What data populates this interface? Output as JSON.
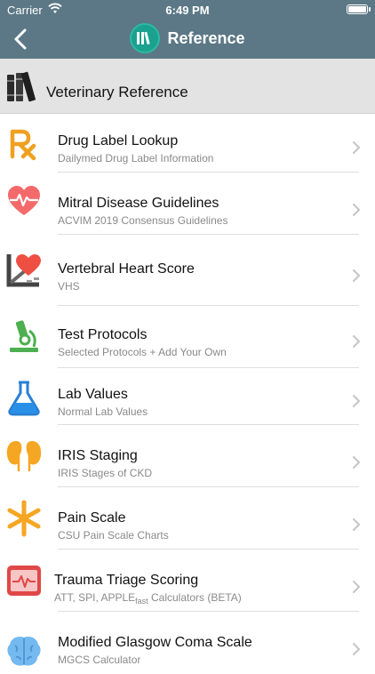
{
  "status": {
    "carrier": "Carrier",
    "time": "6:49 PM"
  },
  "nav": {
    "title": "Reference"
  },
  "section": {
    "label": "Veterinary Reference"
  },
  "items": [
    {
      "title": "Drug Label Lookup",
      "subtitle": "Dailymed Drug Label Information",
      "icon": "rx-icon"
    },
    {
      "title": "Mitral Disease Guidelines",
      "subtitle": "ACVIM 2019 Consensus Guidelines",
      "icon": "heart-pulse-icon"
    },
    {
      "title": "Vertebral Heart Score",
      "subtitle": "VHS",
      "icon": "xray-heart-icon"
    },
    {
      "title": "Test Protocols",
      "subtitle": "Selected Protocols + Add Your Own",
      "icon": "microscope-icon"
    },
    {
      "title": "Lab Values",
      "subtitle": "Normal Lab Values",
      "icon": "flask-icon"
    },
    {
      "title": "IRIS Staging",
      "subtitle": "IRIS Stages of CKD",
      "icon": "kidneys-icon"
    },
    {
      "title": "Pain Scale",
      "subtitle": "CSU Pain Scale Charts",
      "icon": "asterisk-icon"
    },
    {
      "title": "Trauma Triage Scoring",
      "subtitle_a": "ATT, SPI, APPLE",
      "subtitle_sub": "fast",
      "subtitle_b": " Calculators (BETA)",
      "icon": "ecg-monitor-icon"
    },
    {
      "title": "Modified Glasgow Coma Scale",
      "subtitle": "MGCS Calculator",
      "icon": "brain-icon"
    }
  ],
  "colors": {
    "navbar": "#5c7886",
    "logo": "#1aa18f",
    "rx": "#f0a020",
    "heart": "#e8434a"
  }
}
